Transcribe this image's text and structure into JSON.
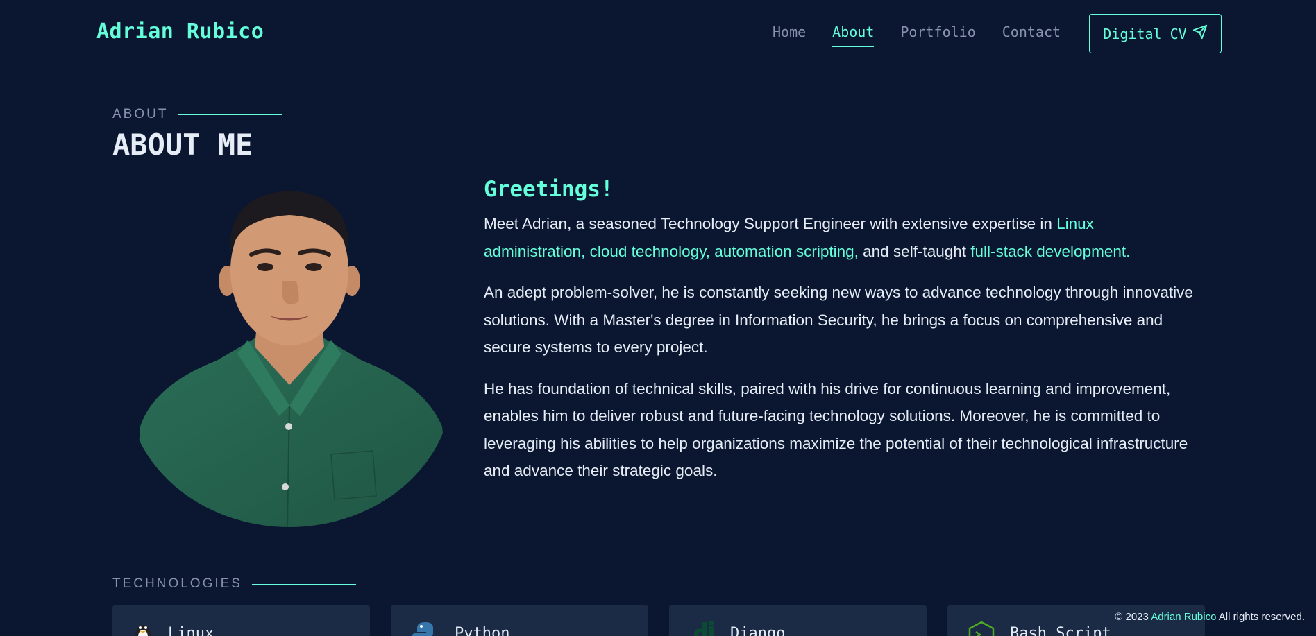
{
  "header": {
    "brand": "Adrian Rubico",
    "nav": [
      {
        "label": "Home",
        "active": false
      },
      {
        "label": "About",
        "active": true
      },
      {
        "label": "Portfolio",
        "active": false
      },
      {
        "label": "Contact",
        "active": false
      }
    ],
    "cv_button": "Digital CV",
    "cv_icon": "paper-plane-icon"
  },
  "about": {
    "eyebrow": "ABOUT",
    "title": "ABOUT ME",
    "greeting": "Greetings!",
    "p1_a": "Meet Adrian, a seasoned Technology Support Engineer with extensive expertise in ",
    "p1_hl1": "Linux administration, cloud technology, automation scripting,",
    "p1_b": " and self-taught ",
    "p1_hl2": "full-stack development.",
    "p2": "An adept problem-solver, he is constantly seeking new ways to advance technology through innovative solutions. With a Master's degree in Information Security, he brings a focus on comprehensive and secure systems to every project.",
    "p3": "He has foundation of technical skills, paired with his drive for continuous learning and improvement, enables him to deliver robust and future-facing technology solutions. Moreover, he is committed to leveraging his abilities to help organizations maximize the potential of their technological infrastructure and advance their strategic goals."
  },
  "technologies": {
    "eyebrow": "TECHNOLOGIES",
    "items": [
      {
        "name": "Linux",
        "icon": "linux-penguin-icon"
      },
      {
        "name": "Python",
        "icon": "python-icon"
      },
      {
        "name": "Django",
        "icon": "django-icon"
      },
      {
        "name": "Bash Script",
        "icon": "bash-icon"
      }
    ]
  },
  "footer": {
    "prefix": "© 2023 ",
    "name": "Adrian Rubico",
    "suffix": " All rights reserved."
  },
  "colors": {
    "background": "#0b1730",
    "accent": "#64ffda",
    "muted": "#8892b0",
    "card": "#1b2a45"
  }
}
